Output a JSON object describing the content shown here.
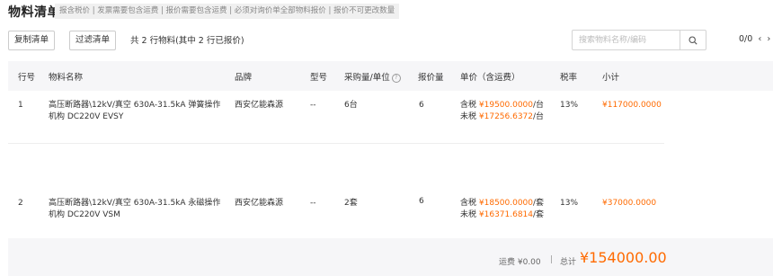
{
  "header": {
    "title": "物料清单",
    "notice": "报含税价 | 发票需要包含运费 | 报价需要包含运费 | 必须对询价单全部物料报价 | 报价不可更改数量"
  },
  "toolbar": {
    "copy_label": "复制清单",
    "filter_label": "过滤清单",
    "summary": "共 2 行物料(其中 2 行已报价)"
  },
  "search": {
    "placeholder": "搜索物料名称/编码"
  },
  "pager": {
    "text": "0/0"
  },
  "table": {
    "columns": {
      "row_no": "行号",
      "name": "物料名称",
      "brand": "品牌",
      "model": "型号",
      "qty": "采购量/单位",
      "quote_qty": "报价量",
      "price": "单价（含运费）",
      "tax": "税率",
      "subtotal": "小计"
    },
    "rows": [
      {
        "no": "1",
        "name_l1": "高压断路器\\12kV/真空 630A-31.5kA 弹簧操作",
        "name_l2": "机构 DC220V EVSY",
        "brand": "西安亿能森源",
        "model": "-- ",
        "qty": "6台",
        "quote_qty": "6",
        "tax_incl_label": "含税",
        "tax_incl_price": "¥19500.0000",
        "tax_incl_unit": "/台",
        "tax_excl_label": "未税",
        "tax_excl_price": "¥17256.6372",
        "tax_excl_unit": "/台",
        "tax_rate": "13%",
        "subtotal": "¥117000.0000"
      },
      {
        "no": "2",
        "name_l1": "高压断路器\\12kV/真空 630A-31.5kA 永磁操作",
        "name_l2": "机构 DC220V VSM",
        "brand": "西安亿能森源",
        "model": "-- ",
        "qty": "2套",
        "quote_qty": "6",
        "tax_incl_label": "含税",
        "tax_incl_price": "¥18500.0000",
        "tax_incl_unit": "/套",
        "tax_excl_label": "未税",
        "tax_excl_price": "¥16371.6814",
        "tax_excl_unit": "/套",
        "tax_rate": "13%",
        "subtotal": "¥37000.0000"
      }
    ]
  },
  "footer": {
    "freight": "运费 ¥0.00",
    "separator": "|",
    "total_label": "总计",
    "total_value": "¥154000.00"
  },
  "colors": {
    "accent": "#ff6a00",
    "header_bg": "#f6f6f8"
  }
}
